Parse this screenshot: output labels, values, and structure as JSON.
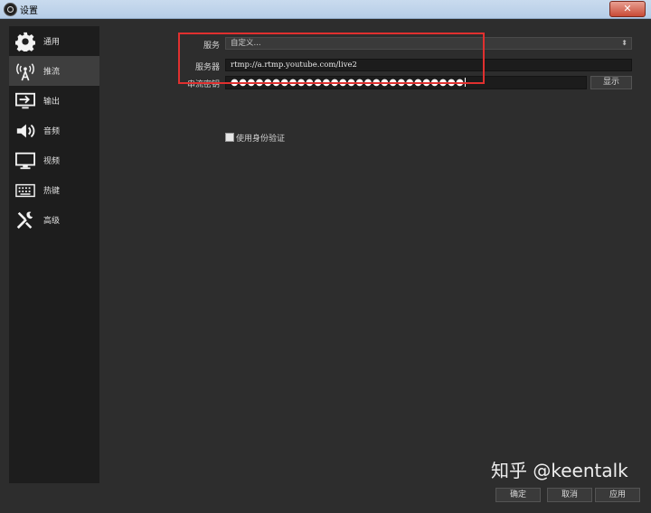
{
  "window": {
    "title": "设置",
    "close_label": "✕"
  },
  "sidebar": {
    "items": [
      {
        "label": "通用",
        "icon": "gear-icon"
      },
      {
        "label": "推流",
        "icon": "broadcast-icon"
      },
      {
        "label": "输出",
        "icon": "output-icon"
      },
      {
        "label": "音频",
        "icon": "speaker-icon"
      },
      {
        "label": "视频",
        "icon": "monitor-icon"
      },
      {
        "label": "热键",
        "icon": "keyboard-icon"
      },
      {
        "label": "高级",
        "icon": "tools-icon"
      }
    ],
    "active_index": 1
  },
  "stream": {
    "service_label": "服务",
    "service_value": "自定义...",
    "server_label": "服务器",
    "server_value": "rtmp://a.rtmp.youtube.com/live2",
    "key_label": "串流密钥",
    "key_value": "●●●●●●●●●●●●●●●●●●●●●●●●●●●●",
    "show_button": "显示",
    "auth_label": "使用身份验证",
    "auth_checked": false
  },
  "footer": {
    "ok": "确定",
    "cancel": "取消",
    "apply": "应用"
  },
  "watermark": "知乎 @keentalk",
  "colors": {
    "highlight": "#e0302f",
    "sidebar_bg": "#1d1d1d",
    "active_item": "#3e3e3e"
  }
}
